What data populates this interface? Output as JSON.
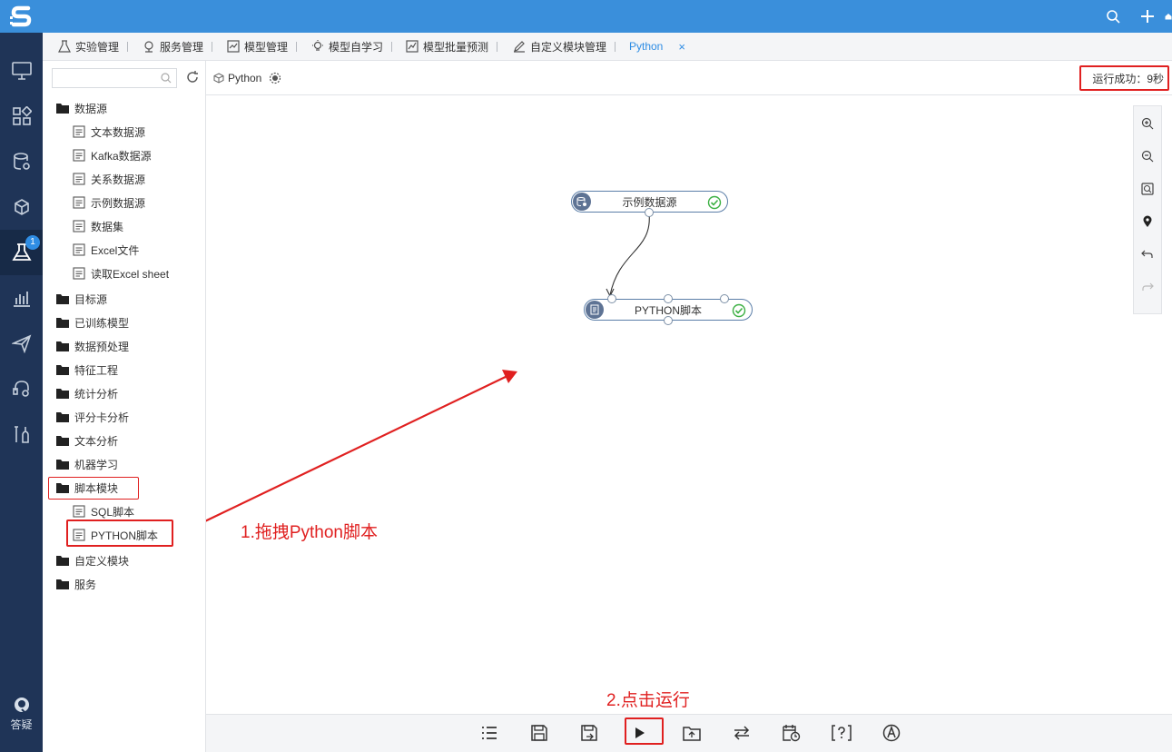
{
  "tabs": [
    {
      "label": "实验管理",
      "icon": "flask-icon"
    },
    {
      "label": "服务管理",
      "icon": "service-icon"
    },
    {
      "label": "模型管理",
      "icon": "chart-icon"
    },
    {
      "label": "模型自学习",
      "icon": "bulb-icon"
    },
    {
      "label": "模型批量预测",
      "icon": "trend-icon"
    },
    {
      "label": "自定义模块管理",
      "icon": "pen-icon"
    },
    {
      "label": "Python",
      "icon": "",
      "active": true
    }
  ],
  "tab_close": "×",
  "rail": {
    "badge_count": "1",
    "help_label": "答疑"
  },
  "sidebar": {
    "search_placeholder": "",
    "tree": [
      {
        "label": "数据源",
        "type": "folder"
      },
      {
        "label": "文本数据源",
        "type": "leaf"
      },
      {
        "label": "Kafka数据源",
        "type": "leaf"
      },
      {
        "label": "关系数据源",
        "type": "leaf"
      },
      {
        "label": "示例数据源",
        "type": "leaf"
      },
      {
        "label": "数据集",
        "type": "leaf"
      },
      {
        "label": "Excel文件",
        "type": "leaf"
      },
      {
        "label": "读取Excel sheet",
        "type": "leaf"
      },
      {
        "label": "目标源",
        "type": "folder"
      },
      {
        "label": "已训练模型",
        "type": "folder"
      },
      {
        "label": "数据预处理",
        "type": "folder"
      },
      {
        "label": "特征工程",
        "type": "folder"
      },
      {
        "label": "统计分析",
        "type": "folder"
      },
      {
        "label": "评分卡分析",
        "type": "folder"
      },
      {
        "label": "文本分析",
        "type": "folder"
      },
      {
        "label": "机器学习",
        "type": "folder"
      },
      {
        "label": "脚本模块",
        "type": "folder"
      },
      {
        "label": "SQL脚本",
        "type": "leaf"
      },
      {
        "label": "PYTHON脚本",
        "type": "leaf"
      },
      {
        "label": "自定义模块",
        "type": "folder"
      },
      {
        "label": "服务",
        "type": "folder"
      }
    ]
  },
  "canvas": {
    "breadcrumb": "Python",
    "status": "运行成功：9秒",
    "nodes": [
      {
        "label": "示例数据源",
        "state": "success"
      },
      {
        "label": "PYTHON脚本",
        "state": "success"
      }
    ]
  },
  "annotations": {
    "step1": "1.拖拽Python脚本",
    "step2": "2.点击运行"
  },
  "colors": {
    "accent": "#3a8fdb",
    "rail": "#1f3457",
    "highlight": "#e02020",
    "success": "#3cb043"
  }
}
